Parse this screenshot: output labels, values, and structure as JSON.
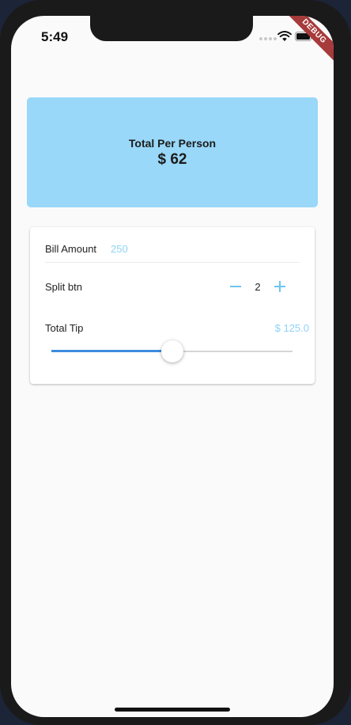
{
  "status_bar": {
    "time": "5:49",
    "debug_banner": "DEBUG"
  },
  "summary": {
    "title": "Total Per Person",
    "amount": "$ 62"
  },
  "bill": {
    "label": "Bill Amount",
    "value": "250"
  },
  "split": {
    "label": "Split btn",
    "count": "2",
    "minus_icon": "minus-icon",
    "plus_icon": "plus-icon"
  },
  "tip": {
    "label": "Total Tip",
    "value": "$ 125.0",
    "slider_fraction": 0.5
  },
  "colors": {
    "summary_card": "#99d8f9",
    "accent": "#6bc6f2",
    "slider_active": "#3d8ce0",
    "debug_banner": "#a73a3a"
  }
}
